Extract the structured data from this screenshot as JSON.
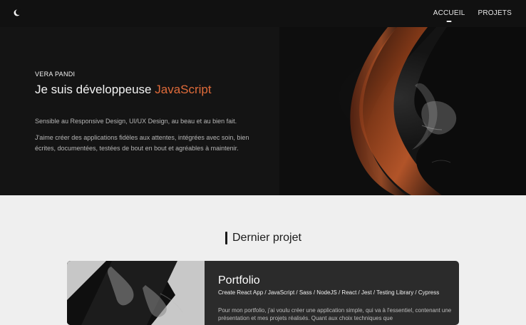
{
  "header": {
    "theme_toggle_icon": "moon-icon",
    "nav": [
      {
        "label": "ACCUEIL",
        "active": true
      },
      {
        "label": "PROJETS",
        "active": false
      }
    ]
  },
  "hero": {
    "eyebrow": "VERA PANDI",
    "headline_prefix": "Je suis développeuse",
    "headline_accent": "JavaScript",
    "paragraph_1": "Sensible au Responsive Design, UI/UX Design, au beau et au bien fait.",
    "paragraph_2": "J'aime créer des applications fidèles aux attentes, intégrées avec soin, bien écrites, documentées, testées de bout en bout et agréables à maintenir.",
    "portrait_icon": "portrait-image",
    "colors": {
      "accent": "#e06b3a",
      "background": "#141414"
    }
  },
  "section": {
    "title": "Dernier projet"
  },
  "project": {
    "title": "Portfolio",
    "tags": "Create React App / JavaScript / Sass / NodeJS / React / Jest / Testing Library / Cypress",
    "description": "Pour mon portfolio, j'ai voulu créer une application simple, qui va à l'essentiel, contenant une présentation et mes projets réalisés. Quant aux choix techniques que",
    "thumbnail_icon": "portfolio-thumbnail"
  }
}
